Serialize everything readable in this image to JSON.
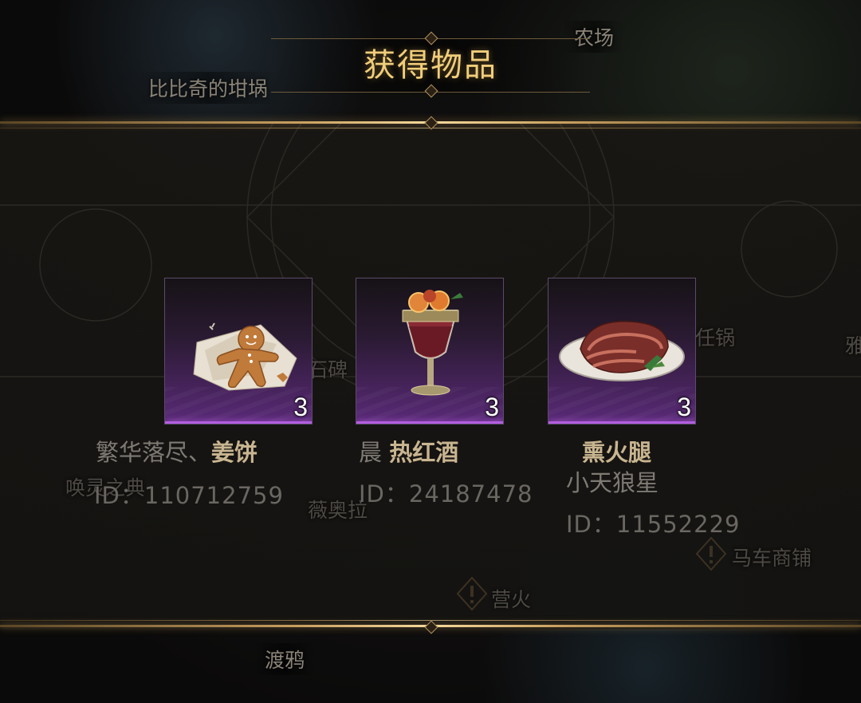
{
  "dialog": {
    "title": "获得物品"
  },
  "map_labels": {
    "farm": "农场",
    "bibiqi_crucible": "比比奇的坩埚",
    "raven": "渡鸦",
    "carriage_shop": "马车商铺",
    "campfire": "营火",
    "viola": "薇奥拉",
    "summon_codex": "唤灵之典",
    "stele": "石碑",
    "pot": "任锅",
    "edge_char": "雅"
  },
  "items": [
    {
      "icon": "gingerbread-icon",
      "quantity": "3",
      "owner": "繁华落尽、",
      "name": "姜饼",
      "id_text": "ID：110712759"
    },
    {
      "icon": "mulled-wine-icon",
      "quantity": "3",
      "owner": "晨 ",
      "name": "热红酒",
      "id_text": "ID：24187478"
    },
    {
      "icon": "smoked-ham-icon",
      "quantity": "3",
      "owner": "小天狼星",
      "name": "熏火腿",
      "id_text": "ID：11552229"
    }
  ],
  "colors": {
    "title_gold": "#f0cd7a",
    "rarity_purple": "#5a2a78",
    "frame_gold": "#c9a060"
  }
}
